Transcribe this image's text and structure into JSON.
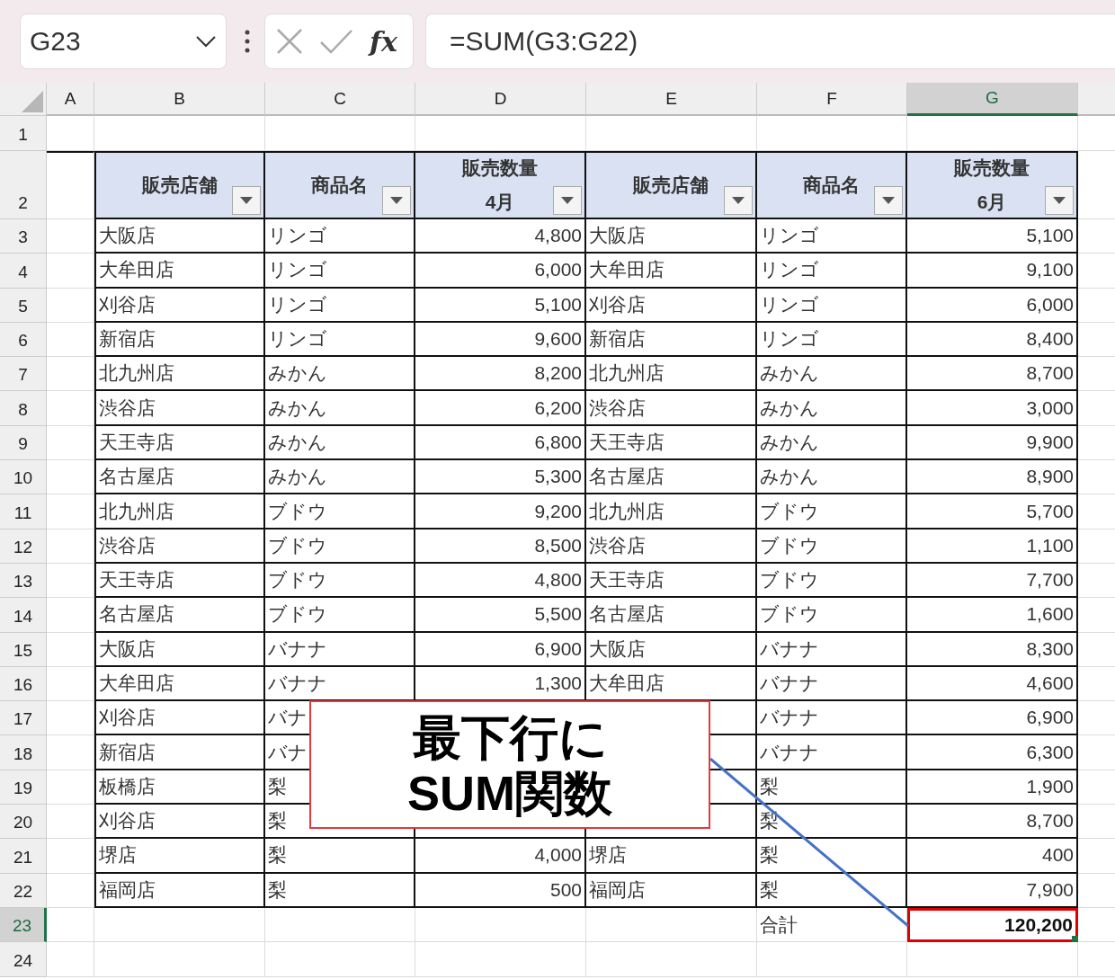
{
  "formula_bar": {
    "name_box": "G23",
    "function_label": "fx",
    "formula": "=SUM(G3:G22)"
  },
  "grid": {
    "columns": [
      {
        "letter": "A",
        "selected": false,
        "kind": "text"
      },
      {
        "letter": "B",
        "selected": false,
        "kind": "text"
      },
      {
        "letter": "C",
        "selected": false,
        "kind": "text"
      },
      {
        "letter": "D",
        "selected": false,
        "kind": "number"
      },
      {
        "letter": "E",
        "selected": false,
        "kind": "text"
      },
      {
        "letter": "F",
        "selected": false,
        "kind": "text"
      },
      {
        "letter": "G",
        "selected": true,
        "kind": "number"
      }
    ],
    "rows": [
      {
        "number": "1",
        "selected": false,
        "kind": "blank"
      },
      {
        "number": "2",
        "selected": false,
        "kind": "header",
        "cells": {
          "B": [
            "販売店舗"
          ],
          "C": [
            "商品名"
          ],
          "D": [
            "販売数量",
            "4月"
          ],
          "E": [
            "販売店舗"
          ],
          "F": [
            "商品名"
          ],
          "G": [
            "販売数量",
            "6月"
          ]
        }
      },
      {
        "number": "3",
        "selected": false,
        "kind": "data",
        "cells": {
          "B": "大阪店",
          "C": "リンゴ",
          "D": "4,800",
          "E": "大阪店",
          "F": "リンゴ",
          "G": "5,100"
        }
      },
      {
        "number": "4",
        "selected": false,
        "kind": "data",
        "cells": {
          "B": "大牟田店",
          "C": "リンゴ",
          "D": "6,000",
          "E": "大牟田店",
          "F": "リンゴ",
          "G": "9,100"
        }
      },
      {
        "number": "5",
        "selected": false,
        "kind": "data",
        "cells": {
          "B": "刈谷店",
          "C": "リンゴ",
          "D": "5,100",
          "E": "刈谷店",
          "F": "リンゴ",
          "G": "6,000"
        }
      },
      {
        "number": "6",
        "selected": false,
        "kind": "data",
        "cells": {
          "B": "新宿店",
          "C": "リンゴ",
          "D": "9,600",
          "E": "新宿店",
          "F": "リンゴ",
          "G": "8,400"
        }
      },
      {
        "number": "7",
        "selected": false,
        "kind": "data",
        "cells": {
          "B": "北九州店",
          "C": "みかん",
          "D": "8,200",
          "E": "北九州店",
          "F": "みかん",
          "G": "8,700"
        }
      },
      {
        "number": "8",
        "selected": false,
        "kind": "data",
        "cells": {
          "B": "渋谷店",
          "C": "みかん",
          "D": "6,200",
          "E": "渋谷店",
          "F": "みかん",
          "G": "3,000"
        }
      },
      {
        "number": "9",
        "selected": false,
        "kind": "data",
        "cells": {
          "B": "天王寺店",
          "C": "みかん",
          "D": "6,800",
          "E": "天王寺店",
          "F": "みかん",
          "G": "9,900"
        }
      },
      {
        "number": "10",
        "selected": false,
        "kind": "data",
        "cells": {
          "B": "名古屋店",
          "C": "みかん",
          "D": "5,300",
          "E": "名古屋店",
          "F": "みかん",
          "G": "8,900"
        }
      },
      {
        "number": "11",
        "selected": false,
        "kind": "data",
        "cells": {
          "B": "北九州店",
          "C": "ブドウ",
          "D": "9,200",
          "E": "北九州店",
          "F": "ブドウ",
          "G": "5,700"
        }
      },
      {
        "number": "12",
        "selected": false,
        "kind": "data",
        "cells": {
          "B": "渋谷店",
          "C": "ブドウ",
          "D": "8,500",
          "E": "渋谷店",
          "F": "ブドウ",
          "G": "1,100"
        }
      },
      {
        "number": "13",
        "selected": false,
        "kind": "data",
        "cells": {
          "B": "天王寺店",
          "C": "ブドウ",
          "D": "4,800",
          "E": "天王寺店",
          "F": "ブドウ",
          "G": "7,700"
        }
      },
      {
        "number": "14",
        "selected": false,
        "kind": "data",
        "cells": {
          "B": "名古屋店",
          "C": "ブドウ",
          "D": "5,500",
          "E": "名古屋店",
          "F": "ブドウ",
          "G": "1,600"
        }
      },
      {
        "number": "15",
        "selected": false,
        "kind": "data",
        "cells": {
          "B": "大阪店",
          "C": "バナナ",
          "D": "6,900",
          "E": "大阪店",
          "F": "バナナ",
          "G": "8,300"
        }
      },
      {
        "number": "16",
        "selected": false,
        "kind": "data",
        "cells": {
          "B": "大牟田店",
          "C": "バナナ",
          "D": "1,300",
          "E": "大牟田店",
          "F": "バナナ",
          "G": "4,600"
        }
      },
      {
        "number": "17",
        "selected": false,
        "kind": "data",
        "cells": {
          "B": "刈谷店",
          "C": "バナ",
          "F": "バナナ",
          "G": "6,900"
        }
      },
      {
        "number": "18",
        "selected": false,
        "kind": "data",
        "cells": {
          "B": "新宿店",
          "C": "バナ",
          "F": "バナナ",
          "G": "6,300"
        }
      },
      {
        "number": "19",
        "selected": false,
        "kind": "data",
        "cells": {
          "B": "板橋店",
          "C": "梨",
          "F": "梨",
          "G": "1,900"
        }
      },
      {
        "number": "20",
        "selected": false,
        "kind": "data",
        "cells": {
          "B": "刈谷店",
          "C": "梨",
          "F": "梨",
          "G": "8,700"
        }
      },
      {
        "number": "21",
        "selected": false,
        "kind": "data",
        "cells": {
          "B": "堺店",
          "C": "梨",
          "D": "4,000",
          "E": "堺店",
          "F": "梨",
          "G": "400"
        }
      },
      {
        "number": "22",
        "selected": false,
        "kind": "data",
        "cells": {
          "B": "福岡店",
          "C": "梨",
          "D": "500",
          "E": "福岡店",
          "F": "梨",
          "G": "7,900"
        }
      },
      {
        "number": "23",
        "selected": true,
        "kind": "total",
        "cells": {
          "F": "合計",
          "G": "120,200"
        }
      },
      {
        "number": "24",
        "selected": false,
        "kind": "blank"
      }
    ]
  },
  "callout": {
    "lines": [
      "最下行に",
      "SUM関数"
    ]
  }
}
